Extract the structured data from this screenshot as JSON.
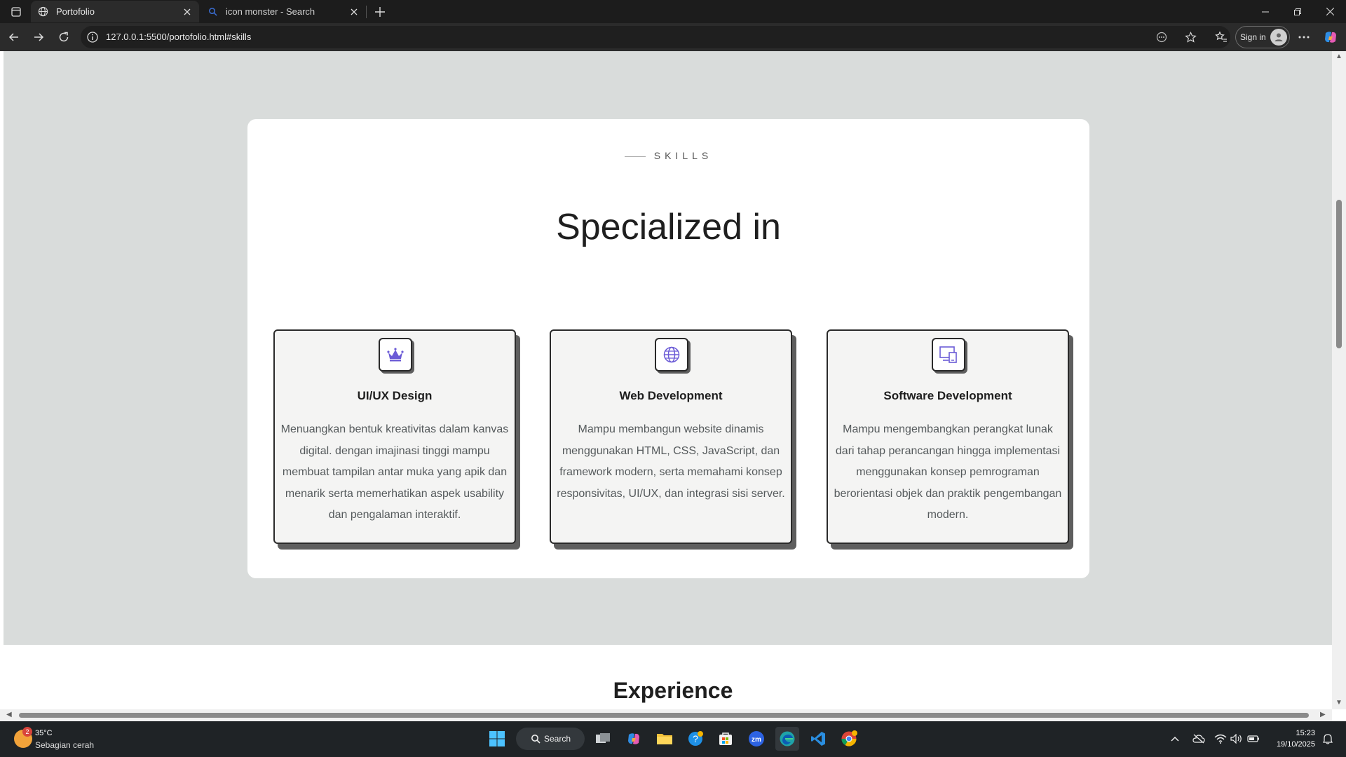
{
  "browser": {
    "tabs": [
      {
        "title": "Portofolio",
        "active": true
      },
      {
        "title": "icon monster - Search",
        "active": false
      }
    ],
    "url": "127.0.0.1:5500/portofolio.html#skills",
    "sign_in_label": "Sign in"
  },
  "skills": {
    "eyebrow": "SKILLS",
    "heading": "Specialized in",
    "items": [
      {
        "title": "UI/UX Design",
        "icon": "crown-icon",
        "description": "Menuangkan bentuk kreativitas dalam kanvas digital. dengan imajinasi tinggi mampu membuat tampilan antar muka yang apik dan menarik serta memerhatikan aspek usability dan pengalaman interaktif."
      },
      {
        "title": "Web Development",
        "icon": "globe-icon",
        "description": "Mampu membangun website dinamis menggunakan HTML, CSS, JavaScript, dan framework modern, serta memahami konsep responsivitas, UI/UX, dan integrasi sisi server."
      },
      {
        "title": "Software Development",
        "icon": "devices-icon",
        "description": "Mampu mengembangkan perangkat lunak dari tahap perancangan hingga implementasi menggunakan konsep pemrograman berorientasi objek dan praktik pengembangan modern."
      }
    ],
    "accent_color": "#6b5bd6"
  },
  "experience": {
    "heading": "Experience"
  },
  "taskbar": {
    "weather_temp": "35°C",
    "weather_desc": "Sebagian cerah",
    "weather_badge": "2",
    "search_label": "Search",
    "time": "15:23",
    "date": "19/10/2025"
  }
}
